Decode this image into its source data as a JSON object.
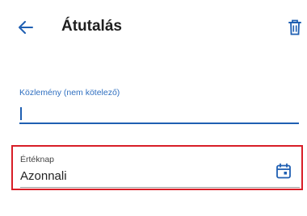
{
  "header": {
    "title": "Átutalás",
    "back_icon": "arrow-left-icon",
    "delete_icon": "trash-icon"
  },
  "memo": {
    "label": "Közlemény (nem kötelező)",
    "value": ""
  },
  "value_date": {
    "label": "Értéknap",
    "value": "Azonnali",
    "icon": "calendar-icon"
  },
  "colors": {
    "accent": "#1f5fb2",
    "highlight_border": "#d81e27"
  }
}
